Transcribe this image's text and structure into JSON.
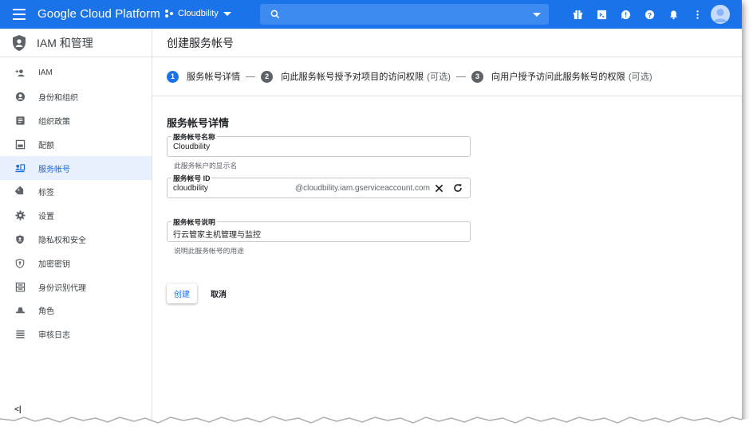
{
  "topbar": {
    "brand": "Google Cloud Platform",
    "project": "Cloudbility",
    "search_placeholder": ""
  },
  "sidebar": {
    "title": "IAM 和管理",
    "items": [
      {
        "label": "IAM",
        "icon": "person-add-icon"
      },
      {
        "label": "身份和组织",
        "icon": "account-circle-icon"
      },
      {
        "label": "组织政策",
        "icon": "list-alt-icon"
      },
      {
        "label": "配额",
        "icon": "quota-icon"
      },
      {
        "label": "服务帐号",
        "icon": "service-account-icon",
        "active": true
      },
      {
        "label": "标签",
        "icon": "label-icon"
      },
      {
        "label": "设置",
        "icon": "settings-icon"
      },
      {
        "label": "隐私权和安全",
        "icon": "privacy-shield-icon"
      },
      {
        "label": "加密密钥",
        "icon": "key-shield-icon"
      },
      {
        "label": "身份识别代理",
        "icon": "identity-proxy-icon"
      },
      {
        "label": "角色",
        "icon": "hat-icon"
      },
      {
        "label": "审核日志",
        "icon": "audit-log-icon"
      }
    ],
    "collapse_label": "<|"
  },
  "main": {
    "title": "创建服务帐号",
    "steps": [
      {
        "num": "1",
        "label": "服务帐号详情",
        "optional": ""
      },
      {
        "num": "2",
        "label": "向此服务帐号授予对项目的访问权限",
        "optional": "(可选)"
      },
      {
        "num": "3",
        "label": "向用户授予访问此服务帐号的权限",
        "optional": "(可选)"
      }
    ],
    "section_title": "服务帐号详情",
    "fields": {
      "name": {
        "label": "服务帐号名称",
        "value": "Cloudbility",
        "hint": "此服务帐户的显示名"
      },
      "id": {
        "label": "服务帐号 ID",
        "value": "cloudbility",
        "suffix": "@cloudbility.iam.gserviceaccount.com"
      },
      "desc": {
        "label": "服务帐号说明",
        "value": "行云管家主机管理与监控",
        "hint": "说明此服务帐号的用途"
      }
    },
    "create_label": "创建",
    "cancel_label": "取消"
  },
  "colors": {
    "primary": "#1a73e8",
    "active_bg": "#e8f0fe",
    "active_text": "#1967d2"
  }
}
